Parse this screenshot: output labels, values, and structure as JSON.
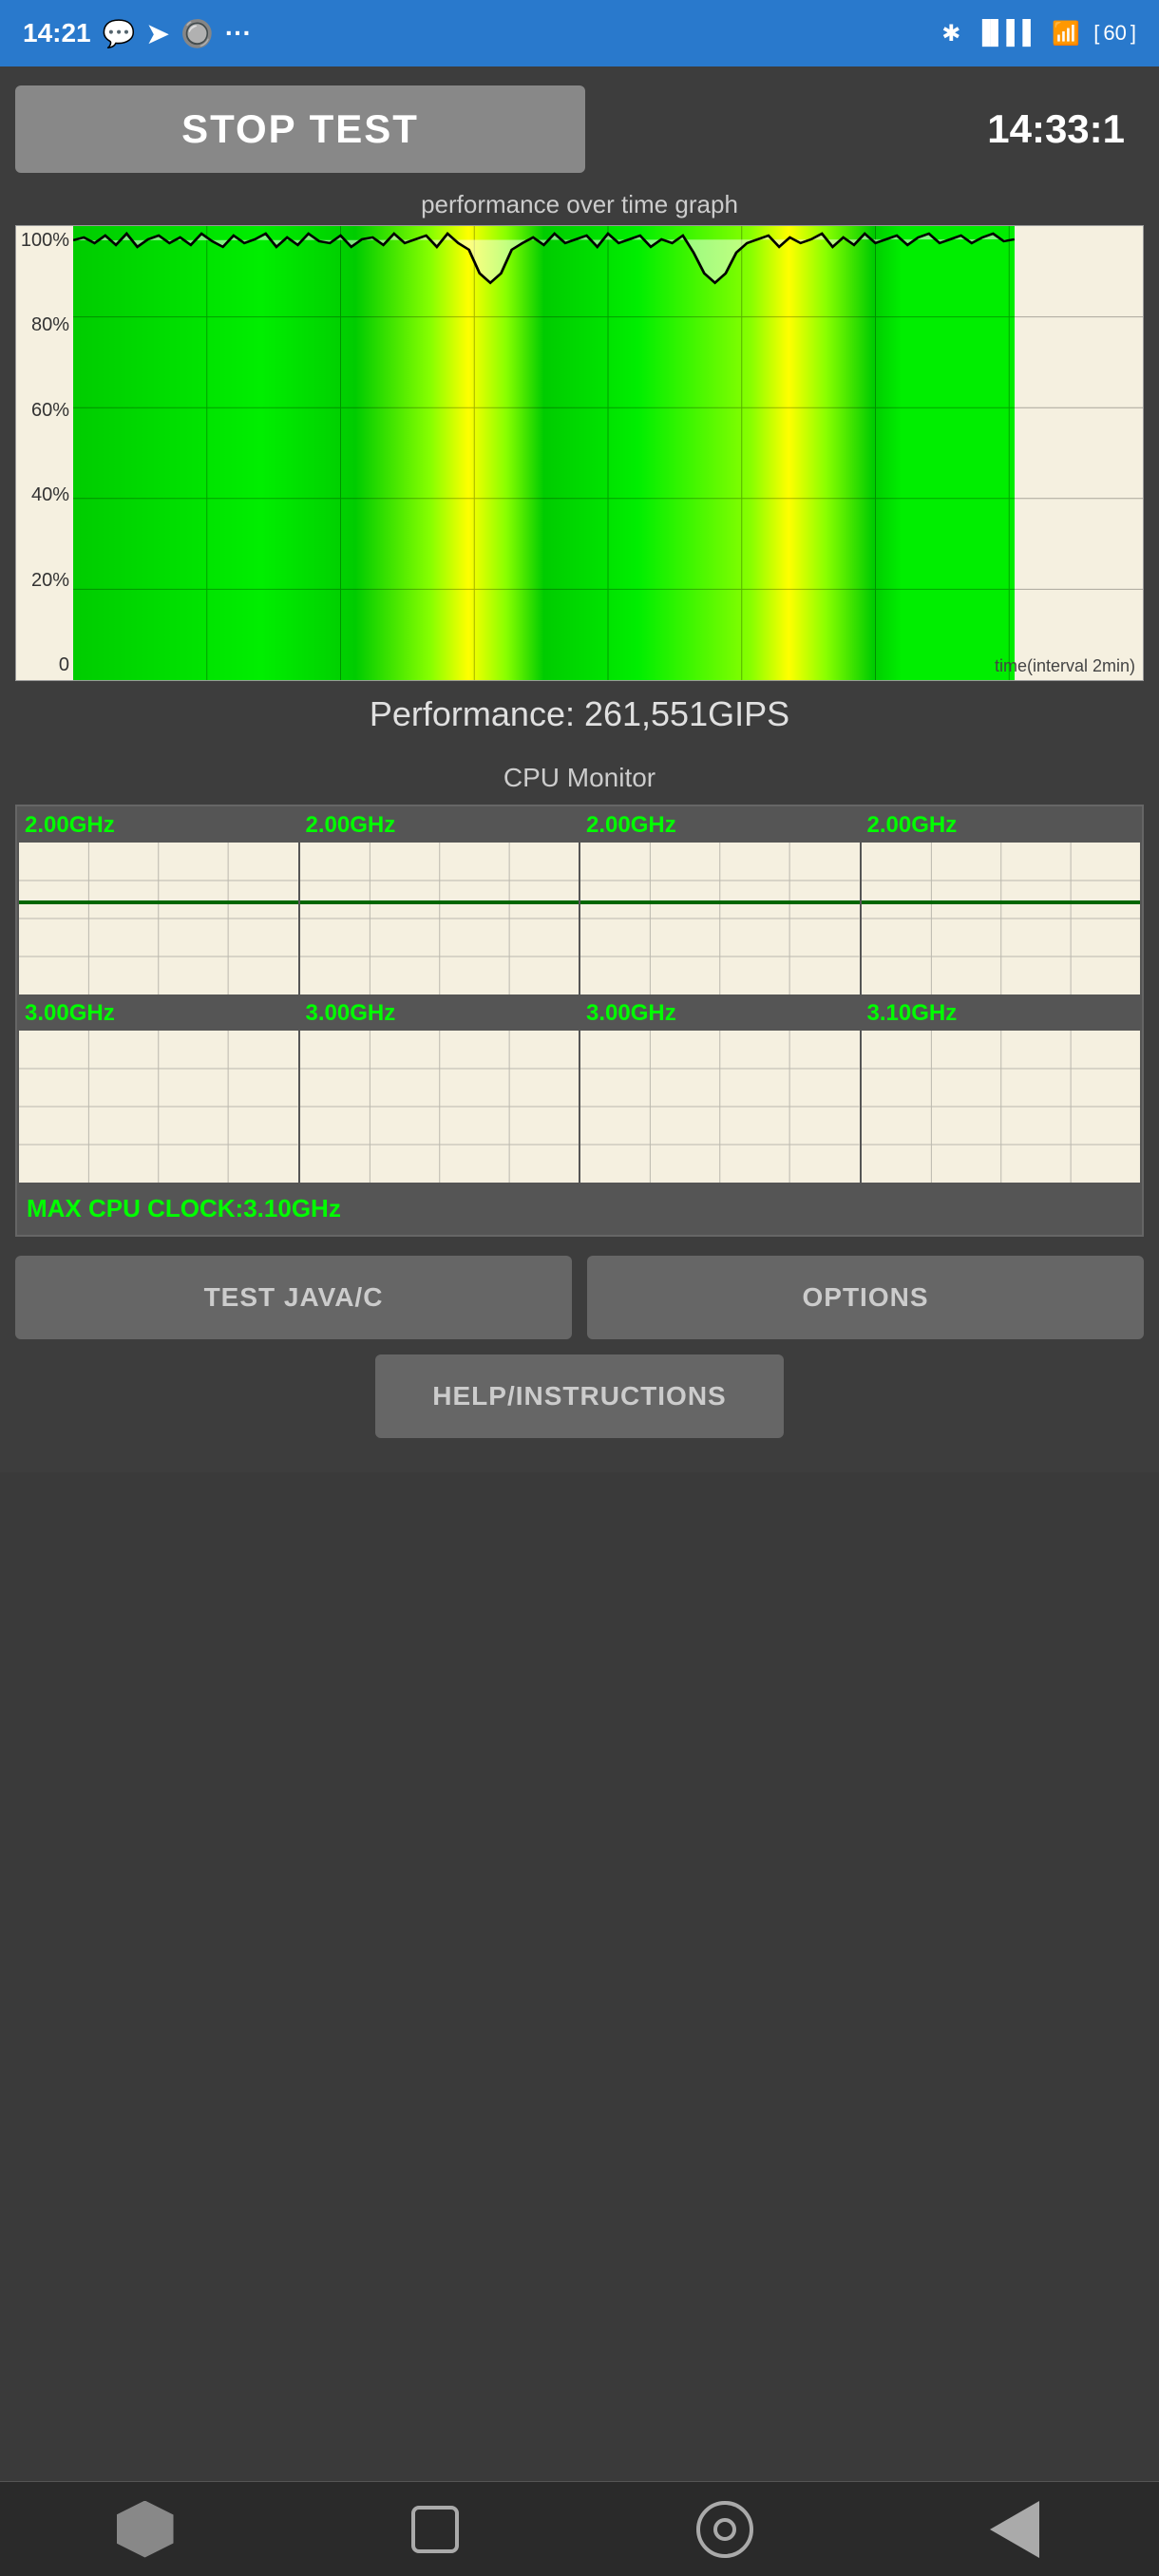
{
  "statusBar": {
    "time": "14:21",
    "batteryLevel": "60"
  },
  "header": {
    "stopBtn": "STOP TEST",
    "timer": "14:33:1"
  },
  "graph": {
    "title": "performance over time graph",
    "yLabels": [
      "100%",
      "80%",
      "60%",
      "40%",
      "20%",
      "0"
    ],
    "timeLabel": "time(interval 2min)"
  },
  "performance": {
    "label": "Performance: 261,551GIPS"
  },
  "cpuMonitor": {
    "title": "CPU Monitor",
    "cores": [
      {
        "freq": "2.00GHz"
      },
      {
        "freq": "2.00GHz"
      },
      {
        "freq": "2.00GHz"
      },
      {
        "freq": "2.00GHz"
      },
      {
        "freq": "3.00GHz"
      },
      {
        "freq": "3.00GHz"
      },
      {
        "freq": "3.00GHz"
      },
      {
        "freq": "3.10GHz"
      }
    ],
    "maxClock": "MAX CPU CLOCK:3.10GHz"
  },
  "buttons": {
    "testJavaC": "TEST JAVA/C",
    "options": "OPTIONS",
    "helpInstructions": "HELP/INSTRUCTIONS"
  },
  "bottomNav": {
    "items": [
      "home",
      "square",
      "circle",
      "back"
    ]
  }
}
